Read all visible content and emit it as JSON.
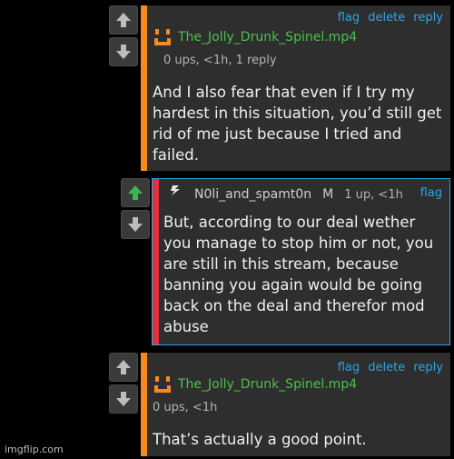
{
  "colors": {
    "accent_orange": "#f58b1f",
    "accent_red": "#e0323c",
    "link_blue": "#2aa6e8",
    "username_green": "#4cc14c",
    "upvote_green": "#3bb84b",
    "card_bg": "#2e2e2e"
  },
  "comments": [
    {
      "avatar_icon": "orange-smiley-icon",
      "username": "The_Jolly_Drunk_Spinel.mp4",
      "meta": "0 ups, <1h, 1 reply",
      "links": [
        "flag",
        "delete",
        "reply"
      ],
      "text": "And I also fear that even if I try my hardest in this situation, you’d still get rid of me just because I tried and failed."
    },
    {
      "avatar_icon": "lightning-icon",
      "username": "N0li_and_spamt0n",
      "badge": "M",
      "meta": "1 up, <1h",
      "links": [
        "flag"
      ],
      "upvoted": true,
      "text": "But, according to our deal wether you manage to stop him or not, you are still in this stream, because banning you again would be going back on the deal and therefor mod abuse"
    },
    {
      "avatar_icon": "orange-smiley-icon",
      "username": "The_Jolly_Drunk_Spinel.mp4",
      "meta": "0 ups, <1h",
      "links": [
        "flag",
        "delete",
        "reply"
      ],
      "text": "That’s actually a good point."
    }
  ],
  "watermark": "imgflip.com"
}
